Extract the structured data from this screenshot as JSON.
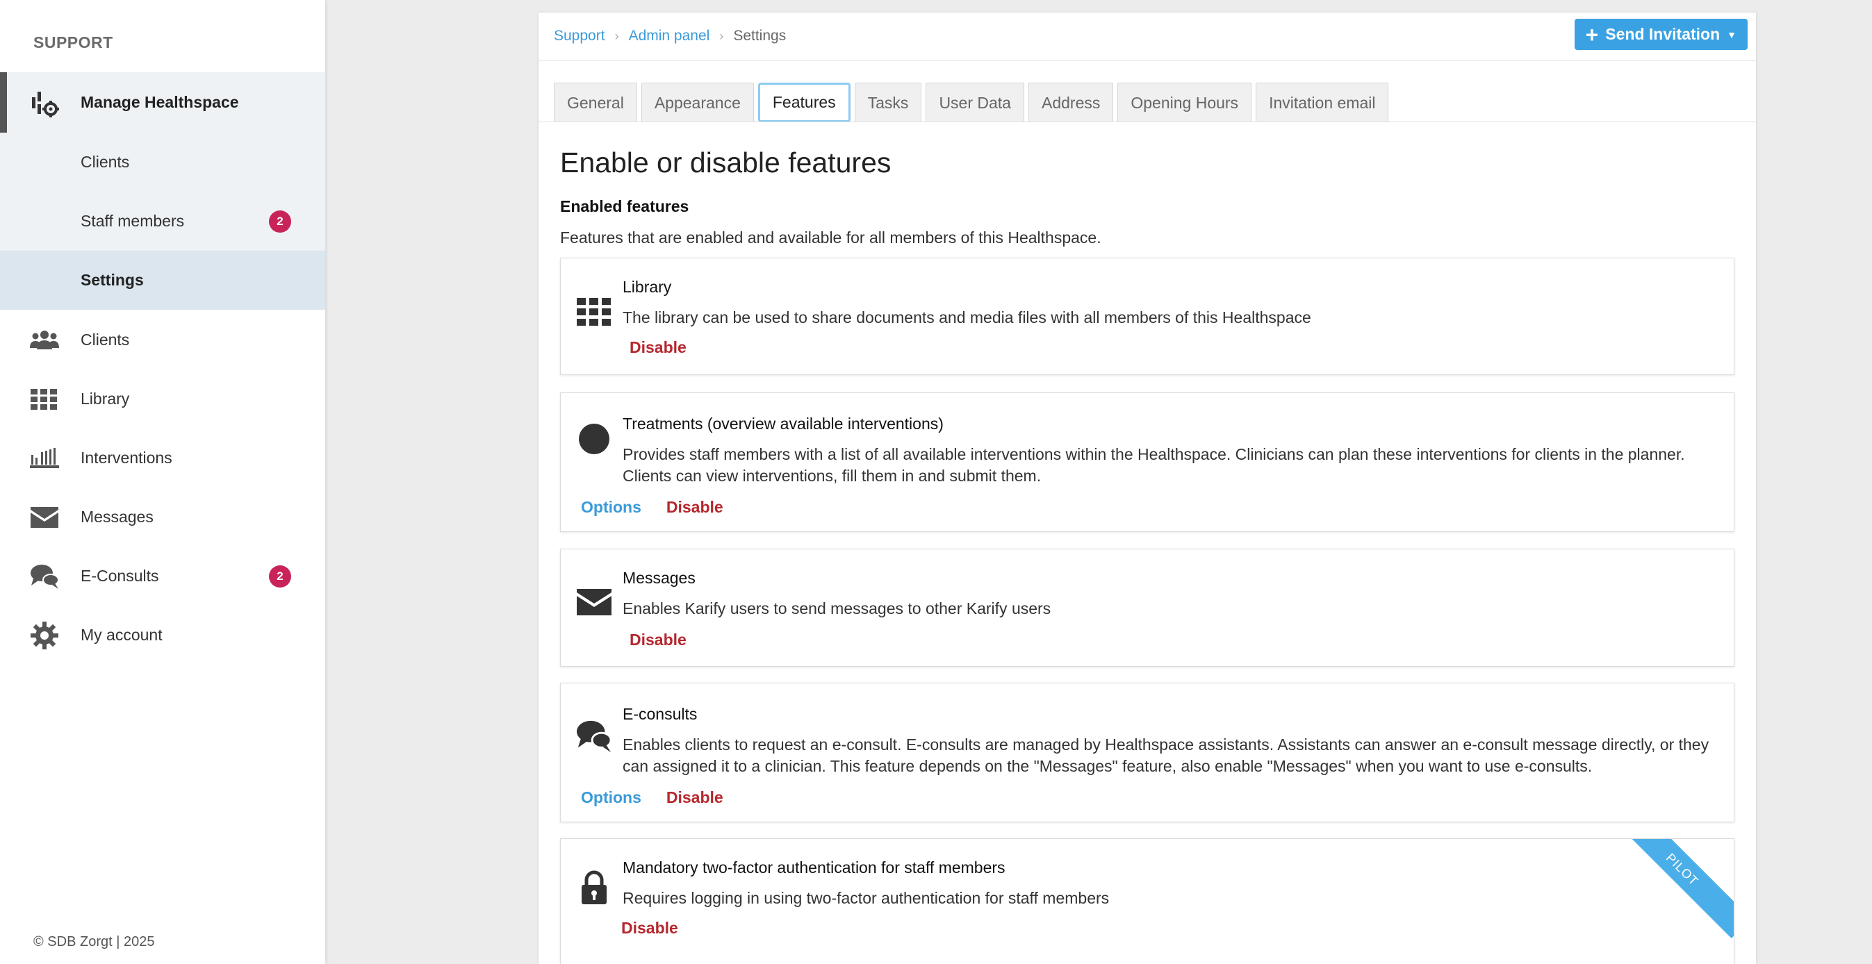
{
  "sidebar": {
    "heading": "SUPPORT",
    "group": {
      "parent_label": "Manage Healthspace",
      "items": [
        {
          "label": "Clients"
        },
        {
          "label": "Staff members",
          "badge": "2"
        },
        {
          "label": "Settings"
        }
      ]
    },
    "main": [
      {
        "label": "Clients",
        "icon": "users-icon"
      },
      {
        "label": "Library",
        "icon": "grid-icon"
      },
      {
        "label": "Interventions",
        "icon": "interventions-icon"
      },
      {
        "label": "Messages",
        "icon": "envelope-icon"
      },
      {
        "label": "E-Consults",
        "icon": "chat-bubbles-icon",
        "badge": "2"
      },
      {
        "label": "My account",
        "icon": "gear-icon"
      }
    ],
    "footer": "© SDB Zorgt | 2025"
  },
  "breadcrumb": {
    "items": [
      "Support",
      "Admin panel"
    ],
    "current": "Settings"
  },
  "send_button": {
    "label": "Send Invitation"
  },
  "tabs": [
    {
      "label": "General"
    },
    {
      "label": "Appearance"
    },
    {
      "label": "Features"
    },
    {
      "label": "Tasks"
    },
    {
      "label": "User Data"
    },
    {
      "label": "Address"
    },
    {
      "label": "Opening Hours"
    },
    {
      "label": "Invitation email"
    }
  ],
  "page": {
    "title": "Enable or disable features",
    "section_title": "Enabled features",
    "section_desc": "Features that are enabled and available for all members of this Healthspace."
  },
  "features": [
    {
      "title": "Library",
      "desc": "The library can be used to share documents and media files with all members of this Healthspace",
      "disable": "Disable",
      "icon": "grid-icon"
    },
    {
      "title": "Treatments (overview available interventions)",
      "desc": "Provides staff members with a list of all available interventions within the Healthspace. Clinicians can plan these interventions for clients in the planner. Clients can view interventions, fill them in and submit them.",
      "options": "Options",
      "disable": "Disable",
      "icon": "circle-icon"
    },
    {
      "title": "Messages",
      "desc": "Enables Karify users to send messages to other Karify users",
      "disable": "Disable",
      "icon": "envelope-icon"
    },
    {
      "title": "E-consults",
      "desc": "Enables clients to request an e-consult. E-consults are managed by Healthspace assistants. Assistants can answer an e-consult message directly, or they can assigned it to a clinician. This feature depends on the \"Messages\" feature, also enable \"Messages\" when you want to use e-consults.",
      "options": "Options",
      "disable": "Disable",
      "icon": "chat-bubbles-icon"
    },
    {
      "title": "Mandatory two-factor authentication for staff members",
      "desc": "Requires logging in using two-factor authentication for staff members",
      "disable": "Disable",
      "ribbon": "PILOT",
      "icon": "lock-icon"
    }
  ]
}
